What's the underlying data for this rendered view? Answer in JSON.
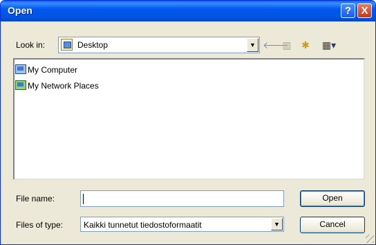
{
  "window": {
    "title": "Open",
    "help_label": "?",
    "close_label": "X"
  },
  "lookin": {
    "label": "Look in:",
    "value": "Desktop"
  },
  "toolbar": {
    "back_glyph": "🡐",
    "up_glyph": "▥",
    "new_folder_glyph": "✱",
    "views_glyph": "▦▾",
    "icons": [
      "back-icon",
      "up-folder-icon",
      "new-folder-icon",
      "views-menu-icon"
    ]
  },
  "files": [
    {
      "name": "My Computer",
      "icon": "my-computer-icon"
    },
    {
      "name": "My Network Places",
      "icon": "network-places-icon"
    }
  ],
  "filename": {
    "label": "File name:",
    "value": ""
  },
  "filetype": {
    "label": "Files of type:",
    "value": "Kaikki tunnetut tiedostoformaatit"
  },
  "buttons": {
    "open": "Open",
    "cancel": "Cancel"
  },
  "colors": {
    "titlebar": "#0054e3",
    "dialog_bg": "#ece9d8",
    "close_button": "#c4381b"
  }
}
